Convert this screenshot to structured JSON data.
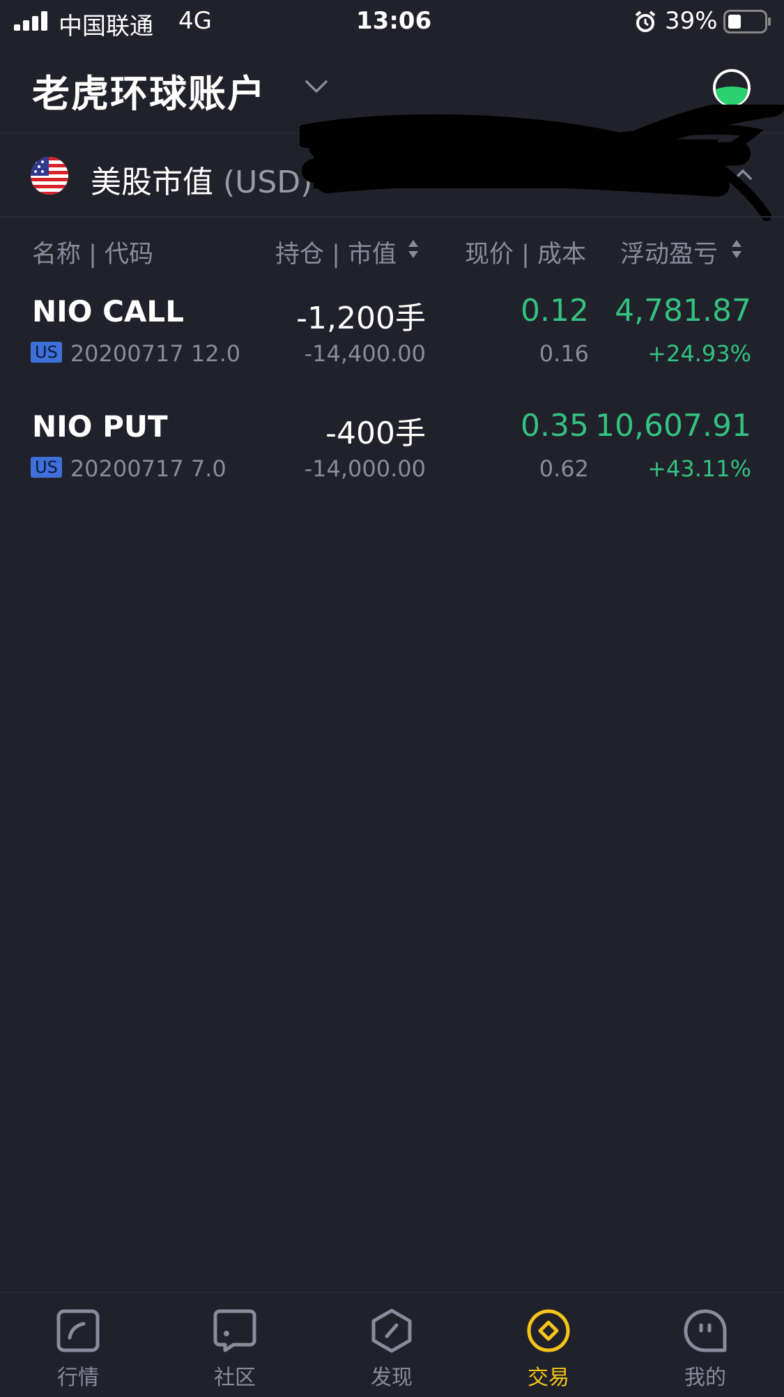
{
  "status_bar": {
    "carrier": "中国联通",
    "network": "4G",
    "time": "13:06",
    "battery": "39%"
  },
  "header": {
    "title": "老虎环球账户"
  },
  "market": {
    "label": "美股市值",
    "currency": "(USD)"
  },
  "table": {
    "headers": {
      "name": "名称 | 代码",
      "position": "持仓 | 市值",
      "price": "现价 | 成本",
      "pnl": "浮动盈亏"
    },
    "rows": [
      {
        "name": "NIO CALL",
        "badge": "US",
        "code": "20200717 12.0",
        "position": "-1,200手",
        "market_value": "-14,400.00",
        "price": "0.12",
        "cost": "0.16",
        "pnl": "4,781.87",
        "pnl_pct": "+24.93%"
      },
      {
        "name": "NIO PUT",
        "badge": "US",
        "code": "20200717 7.0",
        "position": "-400手",
        "market_value": "-14,000.00",
        "price": "0.35",
        "cost": "0.62",
        "pnl": "10,607.91",
        "pnl_pct": "+43.11%"
      }
    ]
  },
  "tabbar": {
    "items": [
      {
        "label": "行情",
        "icon": "chart-icon"
      },
      {
        "label": "社区",
        "icon": "community-icon"
      },
      {
        "label": "发现",
        "icon": "discover-icon"
      },
      {
        "label": "交易",
        "icon": "trade-icon",
        "active": true
      },
      {
        "label": "我的",
        "icon": "profile-icon"
      }
    ]
  },
  "colors": {
    "background": "#21212b",
    "gain": "#33c27f",
    "active_tab": "#f5c518",
    "muted": "#8b8b9c"
  }
}
